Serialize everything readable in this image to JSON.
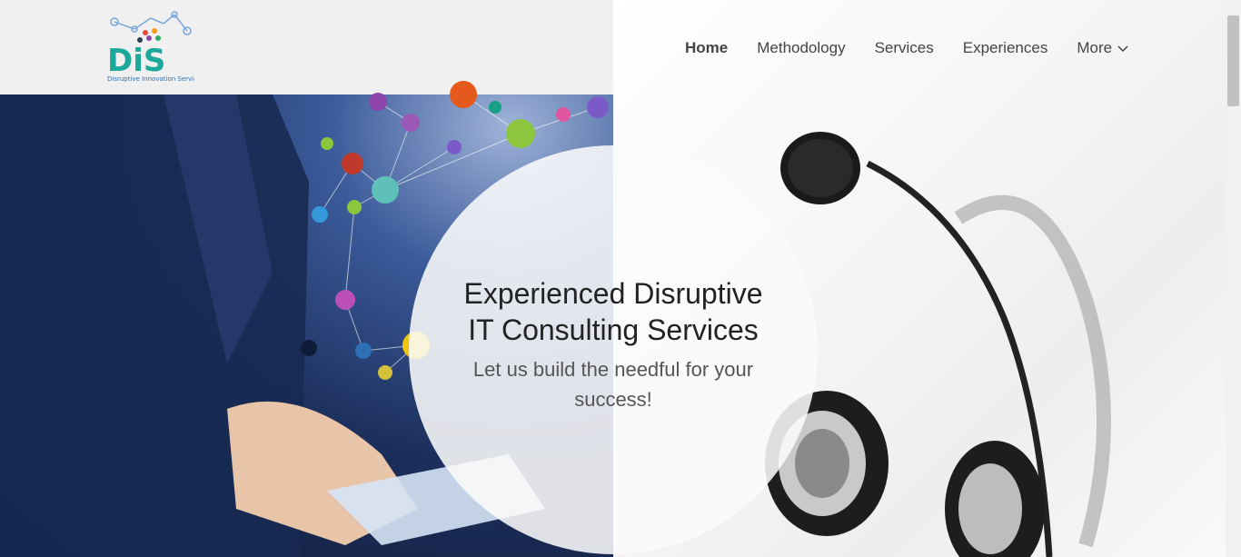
{
  "brand": {
    "logo_text": "DiS",
    "logo_tagline": "Disruptive Innovation Services",
    "colors": {
      "teal": "#1aa99a",
      "blue": "#2f6fb3",
      "accent": "#e74c3c"
    }
  },
  "nav": {
    "items": [
      {
        "label": "Home",
        "active": true
      },
      {
        "label": "Methodology",
        "active": false
      },
      {
        "label": "Services",
        "active": false
      },
      {
        "label": "Experiences",
        "active": false
      },
      {
        "label": "More",
        "active": false,
        "icon": "chevron-down-icon"
      }
    ]
  },
  "hero": {
    "headline_line1": "Experienced Disruptive",
    "headline_line2": "IT Consulting Services",
    "subline": "Let us build the needful for your success!"
  }
}
